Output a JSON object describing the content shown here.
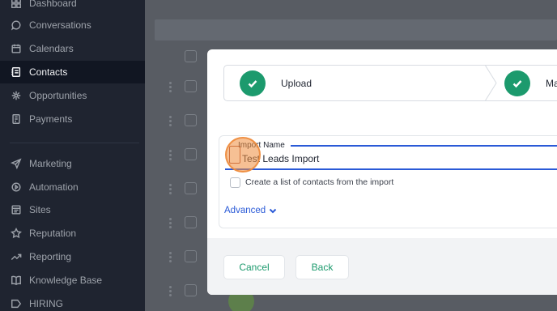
{
  "sidebar": {
    "items": [
      {
        "label": "Dashboard",
        "icon": "dashboard-icon"
      },
      {
        "label": "Conversations",
        "icon": "chat-bubble-icon"
      },
      {
        "label": "Calendars",
        "icon": "calendar-icon"
      },
      {
        "label": "Contacts",
        "icon": "contacts-book-icon",
        "active": true
      },
      {
        "label": "Opportunities",
        "icon": "opportunities-icon"
      },
      {
        "label": "Payments",
        "icon": "payments-icon"
      },
      {
        "label": "Marketing",
        "icon": "paper-plane-icon"
      },
      {
        "label": "Automation",
        "icon": "automation-icon"
      },
      {
        "label": "Sites",
        "icon": "sites-icon"
      },
      {
        "label": "Reputation",
        "icon": "star-icon"
      },
      {
        "label": "Reporting",
        "icon": "trend-line-icon"
      },
      {
        "label": "Knowledge Base",
        "icon": "book-icon"
      },
      {
        "label": "HIRING",
        "icon": "hiring-icon"
      }
    ]
  },
  "modal": {
    "steps": [
      {
        "label": "Upload",
        "status": "complete"
      },
      {
        "label": "Ma",
        "status": "complete"
      }
    ],
    "import_name": {
      "label": "Import Name",
      "value": "Test Leads Import"
    },
    "create_list_label": "Create a list of contacts from the import",
    "advanced_label": "Advanced",
    "cancel_label": "Cancel",
    "back_label": "Back"
  },
  "colors": {
    "accent_green": "#1c9a6d",
    "focus_blue": "#2a5ad7",
    "sidebar_bg": "#1f2430"
  }
}
